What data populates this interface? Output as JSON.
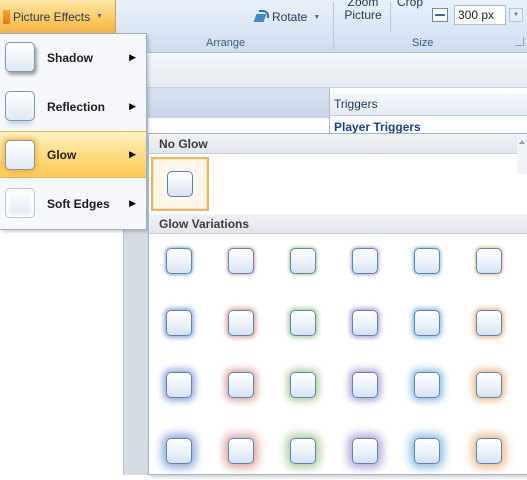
{
  "ribbon": {
    "picture_effects_label": "Picture Effects",
    "rotate_label": "Rotate",
    "zoom_label_line1": "Zoom",
    "zoom_label_line2": "Picture",
    "crop_label": "Crop",
    "width_value": "300 px",
    "groups": {
      "arrange": "Arrange",
      "size": "Size"
    }
  },
  "menu": {
    "items": [
      {
        "label": "Shadow",
        "icon": "shadow-effect-icon",
        "active": false
      },
      {
        "label": "Reflection",
        "icon": "reflection-effect-icon",
        "active": false
      },
      {
        "label": "Glow",
        "icon": "glow-effect-icon",
        "active": true
      },
      {
        "label": "Soft Edges",
        "icon": "soft-edges-effect-icon",
        "active": false
      }
    ]
  },
  "triggers": {
    "title": "Triggers",
    "player_triggers": "Player Triggers"
  },
  "gallery": {
    "no_glow_header": "No Glow",
    "variations_header": "Glow Variations",
    "glow_colors": [
      "#6b8fd1",
      "#d58a84",
      "#97bf7c",
      "#9a8acb",
      "#6aa9d9",
      "#e6a765"
    ],
    "glow_sizes": [
      "5pt",
      "8pt",
      "11pt",
      "18pt"
    ]
  }
}
